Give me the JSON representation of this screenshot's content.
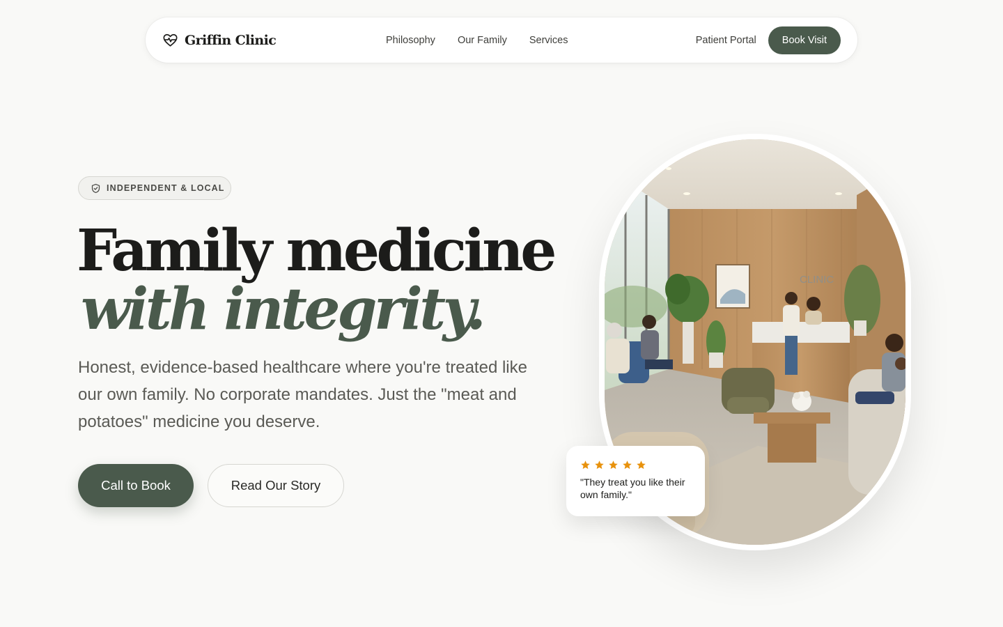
{
  "brand": {
    "name": "Griffin Clinic",
    "icon": "heart-pulse-icon"
  },
  "nav": {
    "links": [
      "Philosophy",
      "Our Family",
      "Services"
    ],
    "portal_label": "Patient Portal",
    "book_label": "Book Visit"
  },
  "hero": {
    "badge": {
      "icon": "shield-check-icon",
      "text": "INDEPENDENT & LOCAL"
    },
    "headline_line1": "Family medicine",
    "headline_line2": "with integrity.",
    "subtext": "Honest, evidence-based healthcare where you're treated like our own family. No corporate mandates. Just the \"meat and potatoes\" medicine you deserve.",
    "primary_cta": "Call to Book",
    "secondary_cta": "Read Our Story",
    "image_sign": "CLINIC"
  },
  "review": {
    "rating": 5,
    "rating_max": 5,
    "quote": "\"They treat you like their own family.\""
  },
  "colors": {
    "accent": "#4a5a4c",
    "background": "#f9f9f7",
    "star": "#e8920d",
    "text": "#1c1c1a"
  }
}
